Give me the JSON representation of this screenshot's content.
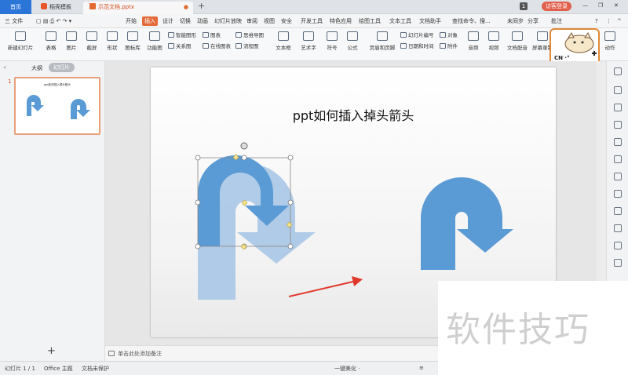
{
  "tabs": {
    "home": "首页",
    "template": "稻壳模板",
    "document": "示范文档.pptx",
    "modified_dot": "●",
    "add": "+"
  },
  "titlebar": {
    "badge": "1",
    "login": "访客登录",
    "minimize": "—",
    "maximize": "❐",
    "close": "✕"
  },
  "menu": {
    "file": "三 文件",
    "items": [
      "开始",
      "插入",
      "设计",
      "切换",
      "动画",
      "幻灯片放映",
      "审阅",
      "视图",
      "安全",
      "开发工具",
      "特色应用",
      "绘图工具",
      "文本工具",
      "文档助手"
    ],
    "active_index": 1,
    "search": "查找命令、搜...",
    "sync": "未同步",
    "share": "分享",
    "comment": "批注",
    "help": "?",
    "more": "⋮",
    "collapse": "^"
  },
  "ribbon": {
    "new_slide": "新建幻灯片",
    "table": "表格",
    "picture": "图片",
    "screenshot": "截屏",
    "shape": "形状",
    "icon_lib": "图标库",
    "function_chart": "功能图",
    "smart_graphic": "智能图形",
    "chart": "图表",
    "mind_map": "思维导图",
    "relation_graph": "关系图",
    "online_chart": "在线图表",
    "flowchart": "流程图",
    "textbox": "文本框",
    "art_text": "艺术字",
    "symbol": "符号",
    "formula": "公式",
    "header_footer": "页眉和页脚",
    "slide_number": "幻灯片编号",
    "object": "对象",
    "datetime": "日期和时间",
    "attachment": "附件",
    "audio": "音频",
    "video": "视频",
    "doc_audio": "文档配音",
    "screen_record": "屏幕录制",
    "action": "动作"
  },
  "mascot": {
    "text": "CN ·°"
  },
  "left_panel": {
    "collapse": "«",
    "outline": "大纲",
    "slides": "幻灯片",
    "slide_number": "1",
    "thumb_title": "ppt如何插入掉头箭头",
    "add": "+"
  },
  "slide": {
    "title": "ppt如何插入掉头箭头"
  },
  "notes": {
    "placeholder": "单击此处添加备注"
  },
  "status": {
    "slide_info": "幻灯片 1 / 1",
    "theme": "Office 主题",
    "protect": "文档未保护",
    "beautify": "一键美化 ·"
  },
  "watermark": {
    "text": "软件技巧"
  },
  "colors": {
    "arrow_blue": "#5b9bd5",
    "arrow_faded": "#a8c7e6",
    "red_arrow": "#e0392c",
    "accent_orange": "#e46a3a",
    "tab_blue": "#2b74d8"
  },
  "icons": {
    "right_tools": [
      "select-icon",
      "copy-icon",
      "shape-icon",
      "style-icon",
      "animation-icon",
      "chart-icon",
      "layout-icon",
      "transition-icon",
      "comment-icon",
      "table-icon",
      "slide-icon",
      "sound-icon",
      "settings-icon",
      "more-icon"
    ]
  }
}
